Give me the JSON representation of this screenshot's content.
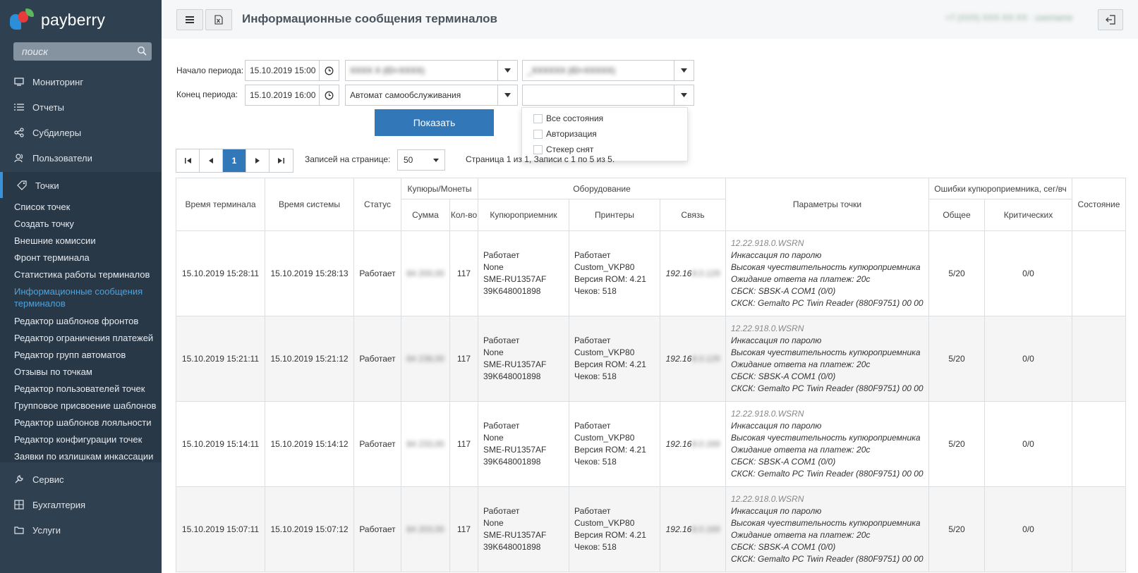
{
  "sidebar": {
    "logo_text": "payberry",
    "search_placeholder": "поиск",
    "nav": [
      {
        "label": "Мониторинг",
        "icon": "monitor-icon"
      },
      {
        "label": "Отчеты",
        "icon": "list-icon"
      },
      {
        "label": "Субдилеры",
        "icon": "share-icon"
      },
      {
        "label": "Пользователи",
        "icon": "users-icon"
      },
      {
        "label": "Точки",
        "icon": "tag-icon"
      }
    ],
    "sub_items": [
      "Список точек",
      "Создать точку",
      "Внешние комиссии",
      "Фронт терминала",
      "Статистика работы терминалов",
      "Информационные сообщения терминалов",
      "Редактор шаблонов фронтов",
      "Редактор ограничения платежей",
      "Редактор групп автоматов",
      "Отзывы по точкам",
      "Редактор пользователей точек",
      "Групповое присвоение шаблонов",
      "Редактор шаблонов лояльности",
      "Редактор конфигурации точек",
      "Заявки по излишкам инкассации"
    ],
    "nav_bottom": [
      {
        "label": "Сервис",
        "icon": "wrench-icon"
      },
      {
        "label": "Бухгалтерия",
        "icon": "calculator-icon"
      },
      {
        "label": "Услуги",
        "icon": "folder-icon"
      }
    ]
  },
  "header": {
    "title": "Информационные сообщения терминалов",
    "user_info": "+7 (XXX) XXX-XX-XX · username"
  },
  "filters": {
    "start_label": "Начало периода:",
    "start_value": "15.10.2019 15:00",
    "end_label": "Конец периода:",
    "end_value": "15.10.2019 16:00",
    "dealer_value": "XXXX X (ID=XXXX)",
    "point_value": "_XXXXXX (ID=XXXXX)",
    "type_value": "Автомат самообслуживания",
    "state_value": "",
    "show_button": "Показать",
    "state_options": [
      "Все состояния",
      "Авторизация",
      "Стекер снят"
    ]
  },
  "pagination": {
    "current_page": "1",
    "per_page_label": "Записей на странице:",
    "per_page_value": "50",
    "page_info": "Страница 1 из 1, Записи с 1 по 5 из 5."
  },
  "table": {
    "headers": {
      "terminal_time": "Время терминала",
      "system_time": "Время системы",
      "status": "Статус",
      "cash_group": "Купюры/Монеты",
      "sum": "Сумма",
      "count": "Кол-во",
      "equipment_group": "Оборудование",
      "acceptor": "Купюроприемник",
      "printers": "Принтеры",
      "link": "Связь",
      "params": "Параметры точки",
      "errors_group": "Ошибки купюроприемника, сег/вч",
      "total": "Общее",
      "critical": "Критических",
      "state": "Состояние"
    },
    "rows": [
      {
        "terminal_time": "15.10.2019 15:28:11",
        "system_time": "15.10.2019 15:28:13",
        "status": "Работает",
        "sum": "84 200,00",
        "count": "117",
        "acceptor": [
          "Работает",
          "None",
          "SME-RU1357AF",
          "39K648001898"
        ],
        "printer": [
          "Работает",
          "Custom_VKP80",
          "Версия ROM: 4.21",
          "Чеков: 518"
        ],
        "link_visible": "192.16",
        "link_hidden": "8.0.129",
        "params": [
          "12.22.918.0.WSRN",
          "Инкассация по паролю",
          "Высокая чуествительность купюроприемника",
          "Ожидание ответа на платеж: 20с",
          "СБСК: SBSK-A COM1 (0/0)",
          "СКСК: Gemalto PC Twin Reader (880F9751) 00 00"
        ],
        "total": "5/20",
        "critical": "0/0",
        "state": ""
      },
      {
        "terminal_time": "15.10.2019 15:21:11",
        "system_time": "15.10.2019 15:21:12",
        "status": "Работает",
        "sum": "84 238,00",
        "count": "117",
        "acceptor": [
          "Работает",
          "None",
          "SME-RU1357AF",
          "39K648001898"
        ],
        "printer": [
          "Работает",
          "Custom_VKP80",
          "Версия ROM: 4.21",
          "Чеков: 518"
        ],
        "link_visible": "192.16",
        "link_hidden": "8.0.129",
        "params": [
          "12.22.918.0.WSRN",
          "Инкассация по паролю",
          "Высокая чуествительность купюроприемника",
          "Ожидание ответа на платеж: 20с",
          "СБСК: SBSK-A COM1 (0/0)",
          "СКСК: Gemalto PC Twin Reader (880F9751) 00 00"
        ],
        "total": "5/20",
        "critical": "0/0",
        "state": ""
      },
      {
        "terminal_time": "15.10.2019 15:14:11",
        "system_time": "15.10.2019 15:14:12",
        "status": "Работает",
        "sum": "84 233,00",
        "count": "117",
        "acceptor": [
          "Работает",
          "None",
          "SME-RU1357AF",
          "39K648001898"
        ],
        "printer": [
          "Работает",
          "Custom_VKP80",
          "Версия ROM: 4.21",
          "Чеков: 518"
        ],
        "link_visible": "192.16",
        "link_hidden": "8.0.169",
        "params": [
          "12.22.918.0.WSRN",
          "Инкассация по паролю",
          "Высокая чуествительность купюроприемника",
          "Ожидание ответа на платеж: 20с",
          "СБСК: SBSK-A COM1 (0/0)",
          "СКСК: Gemalto PC Twin Reader (880F9751) 00 00"
        ],
        "total": "5/20",
        "critical": "0/0",
        "state": ""
      },
      {
        "terminal_time": "15.10.2019 15:07:11",
        "system_time": "15.10.2019 15:07:12",
        "status": "Работает",
        "sum": "84 203,00",
        "count": "117",
        "acceptor": [
          "Работает",
          "None",
          "SME-RU1357AF",
          "39K648001898"
        ],
        "printer": [
          "Работает",
          "Custom_VKP80",
          "Версия ROM: 4.21",
          "Чеков: 518"
        ],
        "link_visible": "192.16",
        "link_hidden": "8.0.169",
        "params": [
          "12.22.918.0.WSRN",
          "Инкассация по паролю",
          "Высокая чуествительность купюроприемника",
          "Ожидание ответа на платеж: 20с",
          "СБСК: SBSK-A COM1 (0/0)",
          "СКСК: Gemalto PC Twin Reader (880F9751) 00 00"
        ],
        "total": "5/20",
        "critical": "0/0",
        "state": ""
      }
    ]
  },
  "colors": {
    "sidebar_bg": "#2f4050",
    "sidebar_sub_bg": "#293846",
    "accent": "#3278b9",
    "active_link": "#4aa3df"
  }
}
